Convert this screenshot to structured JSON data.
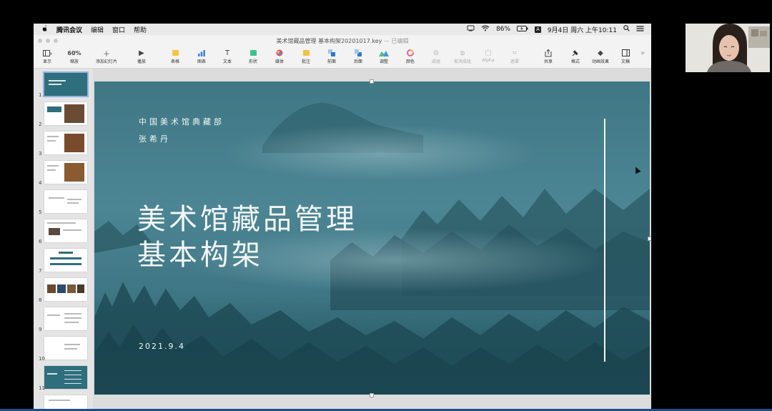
{
  "menubar": {
    "app_name": "腾讯会议",
    "items": [
      "编辑",
      "窗口",
      "帮助"
    ],
    "battery": "86%",
    "input_indicator": "A",
    "datetime": "9月4日 周六 上午10:11"
  },
  "titlebar": {
    "document_title": "美术馆藏品管理 基本构架20201017.key",
    "edited_label": "— 已编辑"
  },
  "toolbar": {
    "zoom_value": "60%",
    "items": [
      {
        "label": "显示",
        "icon": "view-icon"
      },
      {
        "label": "缩放",
        "icon": "zoom-icon"
      },
      {
        "label": "添加幻灯片",
        "icon": "plus-icon"
      },
      {
        "label": "播放",
        "icon": "play-icon"
      },
      {
        "label": "表格",
        "icon": "table-icon"
      },
      {
        "label": "图表",
        "icon": "chart-icon"
      },
      {
        "label": "文本",
        "icon": "text-icon"
      },
      {
        "label": "形状",
        "icon": "shape-icon"
      },
      {
        "label": "媒体",
        "icon": "media-icon"
      },
      {
        "label": "批注",
        "icon": "comment-icon"
      },
      {
        "label": "前面",
        "icon": "front-icon"
      },
      {
        "label": "后面",
        "icon": "back-icon"
      },
      {
        "label": "调整",
        "icon": "adjust-icon"
      },
      {
        "label": "颜色",
        "icon": "color-icon"
      },
      {
        "label": "成组",
        "icon": "group-icon"
      },
      {
        "label": "取消成组",
        "icon": "ungroup-icon"
      },
      {
        "label": "Alpha",
        "icon": "alpha-icon"
      },
      {
        "label": "遮罩",
        "icon": "mask-icon"
      },
      {
        "label": "共享",
        "icon": "share-icon"
      },
      {
        "label": "格式",
        "icon": "format-icon"
      },
      {
        "label": "动画效果",
        "icon": "animate-icon"
      },
      {
        "label": "文稿",
        "icon": "document-icon"
      }
    ]
  },
  "slides": {
    "numbers": [
      "1",
      "2",
      "3",
      "4",
      "5",
      "6",
      "7",
      "8",
      "9",
      "10",
      "11"
    ],
    "selected": 1
  },
  "slide": {
    "org": "中国美术馆典藏部",
    "author": "张希丹",
    "title_line1": "美术馆藏品管理",
    "title_line2": "基本构架",
    "date": "2021.9.4"
  },
  "colors": {
    "slide_teal": "#3f7785",
    "selection_blue": "#8fb2df"
  }
}
